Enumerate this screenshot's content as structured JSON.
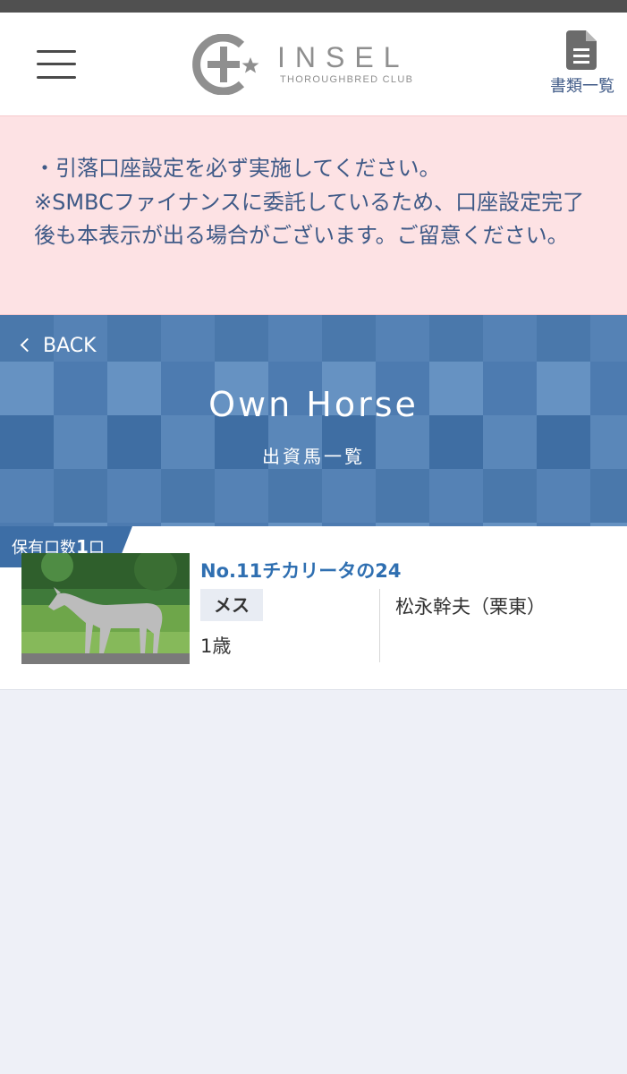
{
  "header": {
    "logo_name": "INSEL",
    "logo_sub": "THOROUGHBRED CLUB",
    "docs_label": "書類一覧",
    "menu_icon": "hamburger-menu-icon",
    "docs_icon": "document-icon"
  },
  "notice": {
    "text": "・引落口座設定を必ず実施してください。\n※SMBCファイナンスに委託しているため、口座設定完了後も本表示が出る場合がございます。ご留意ください。",
    "background": "#fde2e4",
    "text_color": "#3f5a87"
  },
  "hero": {
    "back_label": "BACK",
    "title": "Own Horse",
    "subtitle": "出資馬一覧",
    "color": "#4f7db0"
  },
  "horse": {
    "badge_prefix": "保有口数",
    "badge_count": "1",
    "badge_suffix": "口",
    "name": "No.11チカリータの24",
    "sex": "メス",
    "age": "1歳",
    "trainer": "松永幹夫（栗東）",
    "name_color": "#2f6fb1"
  }
}
